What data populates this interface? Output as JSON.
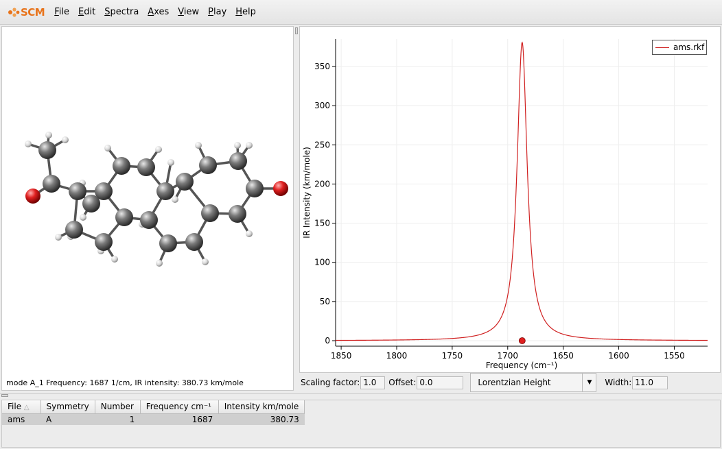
{
  "app": {
    "logo_text": "SCM"
  },
  "menu": [
    {
      "label": "File",
      "underline": "F",
      "rest": "ile"
    },
    {
      "label": "Edit",
      "underline": "E",
      "rest": "dit"
    },
    {
      "label": "Spectra",
      "underline": "S",
      "rest": "pectra"
    },
    {
      "label": "Axes",
      "underline": "A",
      "rest": "xes"
    },
    {
      "label": "View",
      "underline": "V",
      "rest": "iew"
    },
    {
      "label": "Play",
      "underline": "P",
      "rest": "lay"
    },
    {
      "label": "Help",
      "underline": "H",
      "rest": "elp"
    }
  ],
  "molecule": {
    "status": "mode A_1 Frequency: 1687 1/cm, IR intensity: 380.73 km/mole"
  },
  "spectrum": {
    "legend": "ams.rkf",
    "chart_data": {
      "type": "line",
      "xlabel": "Frequency (cm⁻¹)",
      "ylabel": "IR Intensity (km/mole)",
      "xlim": [
        1855,
        1520
      ],
      "ylim": [
        -7,
        385
      ],
      "x_ticks": [
        1850,
        1800,
        1750,
        1700,
        1650,
        1600,
        1550
      ],
      "y_ticks": [
        0,
        50,
        100,
        150,
        200,
        250,
        300,
        350
      ],
      "grid": true,
      "legend_position": "top-right",
      "series": [
        {
          "name": "ams.rkf",
          "color": "#d02020",
          "peak_frequency": 1687,
          "peak_intensity": 380.73,
          "width": 11.0,
          "line_shape": "Lorentzian"
        }
      ],
      "marker": {
        "x": 1687,
        "y": 0,
        "color": "#e02020"
      }
    }
  },
  "controls": {
    "scaling_label": "Scaling factor:",
    "scaling_value": "1.0",
    "offset_label": "Offset:",
    "offset_value": "0.0",
    "lineshape_value": "Lorentzian Height",
    "width_label": "Width:",
    "width_value": "11.0"
  },
  "table": {
    "headers": [
      "File",
      "Symmetry",
      "Number",
      "Frequency cm⁻¹",
      "Intensity km/mole"
    ],
    "rows": [
      [
        "ams",
        "A",
        "1",
        "1687",
        "380.73"
      ]
    ]
  }
}
